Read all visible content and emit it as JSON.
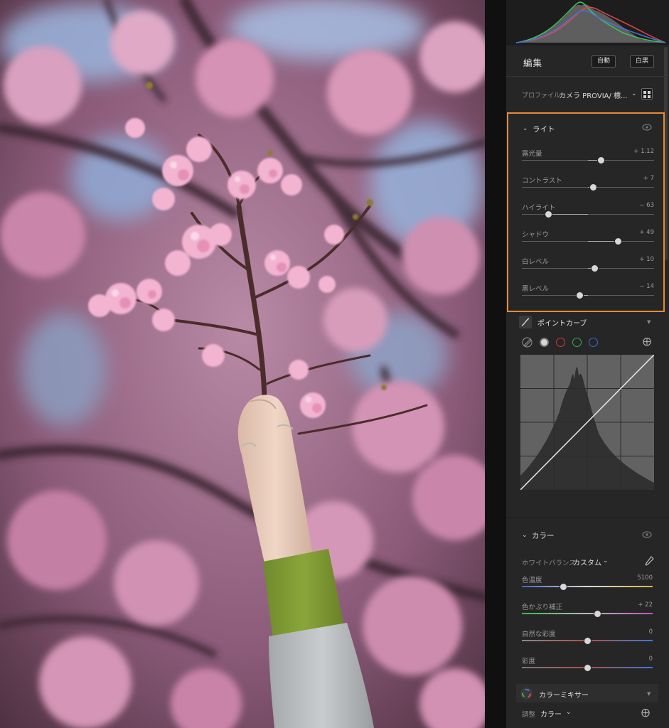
{
  "edit_panel": {
    "title": "編集",
    "auto_label": "自動",
    "bw_label": "白黒"
  },
  "profile": {
    "label": "プロファイル",
    "value": "カメラ PROVIA/ 標...",
    "browse_icon": "profile-browser-icon"
  },
  "light": {
    "title": "ライト",
    "sliders": [
      {
        "label": "露光量",
        "value": "+ 1.12",
        "position": 0.6
      },
      {
        "label": "コントラスト",
        "value": "+ 7",
        "position": 0.54
      },
      {
        "label": "ハイライト",
        "value": "− 63",
        "position": 0.2
      },
      {
        "label": "シャドウ",
        "value": "+ 49",
        "position": 0.73
      },
      {
        "label": "白レベル",
        "value": "+ 10",
        "position": 0.55
      },
      {
        "label": "黒レベル",
        "value": "− 14",
        "position": 0.44
      }
    ]
  },
  "point_curve": {
    "title": "ポイントカーブ"
  },
  "color": {
    "title": "カラー",
    "wb_label": "ホワイトバランス",
    "wb_value": "カスタム",
    "sliders": [
      {
        "label": "色温度",
        "value": "5100",
        "position": 0.32
      },
      {
        "label": "色かぶり補正",
        "value": "+ 22",
        "position": 0.58
      },
      {
        "label": "自然な彩度",
        "value": "0",
        "position": 0.5
      },
      {
        "label": "彩度",
        "value": "0",
        "position": 0.5
      }
    ]
  },
  "color_mixer": {
    "title": "カラーミキサー",
    "adjust_label": "調整",
    "adjust_value": "カラー"
  },
  "colors": {
    "accent": "#e88a36",
    "panel_bg": "#262626"
  }
}
